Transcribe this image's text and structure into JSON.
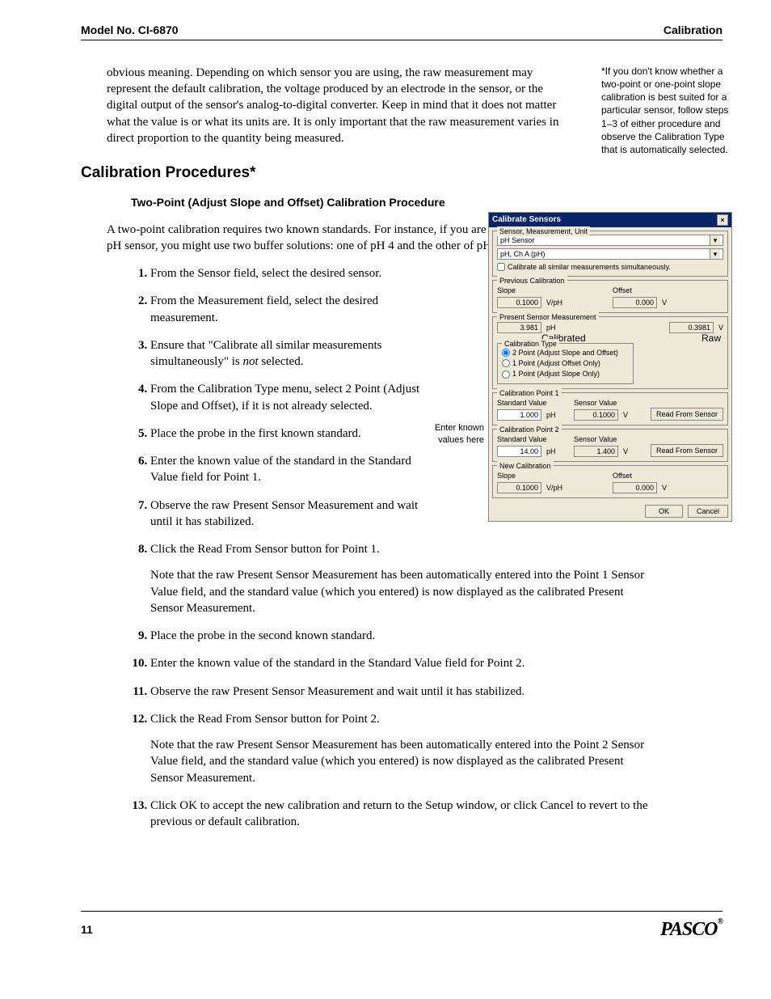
{
  "header": {
    "left": "Model No. CI-6870",
    "right": "Calibration"
  },
  "intro_para": "obvious meaning. Depending on which sensor you are using, the raw measurement may represent the default calibration, the voltage produced by an electrode in the sensor, or the digital output of the sensor's analog-to-digital converter. Keep in mind that it does not matter what the value is or what its units are. It is only important that the raw measurement varies in direct proportion to the quantity being measured.",
  "section_heading": "Calibration Procedures*",
  "side_note": "*If you don't know whether a two-point or one-point slope calibration is best suited for a particular sensor, follow steps 1–3 of either procedure and observe the Calibration Type that is automatically selected.",
  "sub_heading": "Two-Point (Adjust Slope and Offset) Calibration Procedure",
  "lead_para": "A two-point calibration requires two known standards. For instance, if you are calibrating a pH sensor, you might use two buffer solutions: one of pH 4 and the other of pH 7.",
  "steps": {
    "1": "From the Sensor field, select the desired sensor.",
    "2": "From the Measurement field, select the desired measurement.",
    "3_a": "Ensure that \"Calibrate all similar measurements simultaneously\" is ",
    "3_b": "not",
    "3_c": " selected.",
    "4": "From the Calibration Type menu, select 2 Point (Adjust Slope and Offset), if it is not already selected.",
    "5": "Place the probe in the first known standard.",
    "6": "Enter the known value of the standard in the Standard Value field for Point 1.",
    "7": "Observe the raw Present Sensor Measurement and wait until it has stabilized.",
    "8": "Click the Read From Sensor button for Point 1.",
    "8_note": "Note that the raw Present Sensor Measurement has been automatically entered into the Point 1 Sensor Value field, and the standard value (which you entered) is now displayed as the calibrated Present Sensor Measurement.",
    "9": "Place the probe in the second known standard.",
    "10": "Enter the known value of the standard in the Standard Value field for Point 2.",
    "11": "Observe the raw Present Sensor Measurement and wait until it has stabilized.",
    "12": "Click the Read From Sensor button for Point 2.",
    "12_note": "Note that the raw Present Sensor Measurement has been automatically entered into the Point 2 Sensor Value field, and the standard value (which you entered) is now displayed as the calibrated Present Sensor Measurement.",
    "13": "Click OK to accept the new calibration and return to the Setup window, or click Cancel to revert to the previous or default calibration."
  },
  "dialog": {
    "title": "Calibrate Sensors",
    "sensor_group": "Sensor, Measurement, Unit",
    "sensor_dd": "pH Sensor",
    "meas_dd": "pH, Ch A (pH)",
    "checkbox": "Calibrate all similar measurements simultaneously.",
    "prev_group": "Previous Calibration",
    "slope_lbl": "Slope",
    "prev_slope_val": "0.1000",
    "slope_unit": "V/pH",
    "offset_lbl": "Offset",
    "prev_offset_val": "0.000",
    "offset_unit": "V",
    "present_group": "Present Sensor Measurement",
    "present_cal": "3.981",
    "present_cal_unit": "pH",
    "present_raw": "0.3981",
    "present_raw_unit": "V",
    "callout_calibrated": "Calibrated",
    "callout_raw": "Raw",
    "type_group": "Calibration Type",
    "type1": "2 Point (Adjust Slope and Offset)",
    "type2": "1 Point (Adjust Offset Only)",
    "type3": "1 Point (Adjust Slope Only)",
    "pt1_group": "Calibration Point 1",
    "std_lbl": "Standard Value",
    "sv_lbl": "Sensor Value",
    "pt1_std": "1.000",
    "pt1_sv": "0.1000",
    "pt2_group": "Calibration Point 2",
    "pt2_std": "14.00",
    "pt2_sv": "1.400",
    "read_btn": "Read From Sensor",
    "new_group": "New Calibration",
    "new_slope": "0.1000",
    "new_offset": "0.000",
    "ok": "OK",
    "cancel": "Cancel",
    "ph_unit": "pH",
    "v_unit": "V"
  },
  "callout_known": "Enter known values here",
  "footer": {
    "page": "11",
    "brand": "PASCO"
  }
}
